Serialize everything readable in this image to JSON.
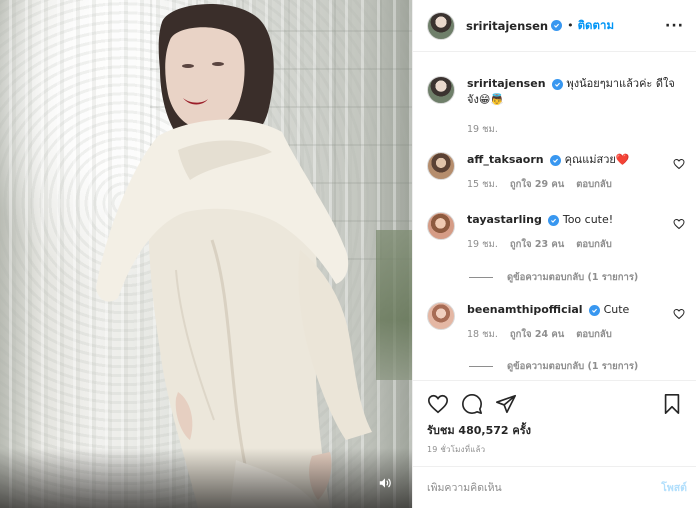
{
  "post": {
    "username": "sriritajensen",
    "follow_label": "ติดตาม",
    "dot": "•",
    "more_label": "···"
  },
  "caption": {
    "username": "sriritajensen",
    "text": "พุงน้อยๆมาแล้วค่ะ ดีใจจัง😁👼",
    "time": "19 ชม."
  },
  "comments": [
    {
      "username": "aff_taksaorn",
      "text": "คุณแม่สวย❤️",
      "time": "15 ชม.",
      "likes": "ถูกใจ 29 คน",
      "reply_label": "ตอบกลับ"
    },
    {
      "username": "tayastarling",
      "text": "Too cute!",
      "time": "19 ชม.",
      "likes": "ถูกใจ 23 คน",
      "reply_label": "ตอบกลับ",
      "view_replies": "ดูข้อความตอบกลับ (1 รายการ)"
    },
    {
      "username": "beenamthipofficial",
      "text": "Cute",
      "time": "18 ชม.",
      "likes": "ถูกใจ 24 คน",
      "reply_label": "ตอบกลับ",
      "view_replies": "ดูข้อความตอบกลับ (1 รายการ)"
    }
  ],
  "stats": {
    "views": "รับชม 480,572 ครั้ง",
    "posted": "19 ชั่วโมงที่แล้ว"
  },
  "add_comment": {
    "placeholder": "เพิ่มความคิดเห็น",
    "post_label": "โพสต์"
  },
  "colors": {
    "accent": "#0095f6",
    "verified": "#3897f0",
    "muted": "#8e8e8e",
    "post_disabled": "#b2dffc"
  },
  "icons": {
    "verified": "verified-badge-icon",
    "like": "heart-icon",
    "comment": "comment-bubble-icon",
    "share": "paper-plane-icon",
    "save": "bookmark-icon",
    "sound": "speaker-icon",
    "more": "ellipsis-icon"
  }
}
